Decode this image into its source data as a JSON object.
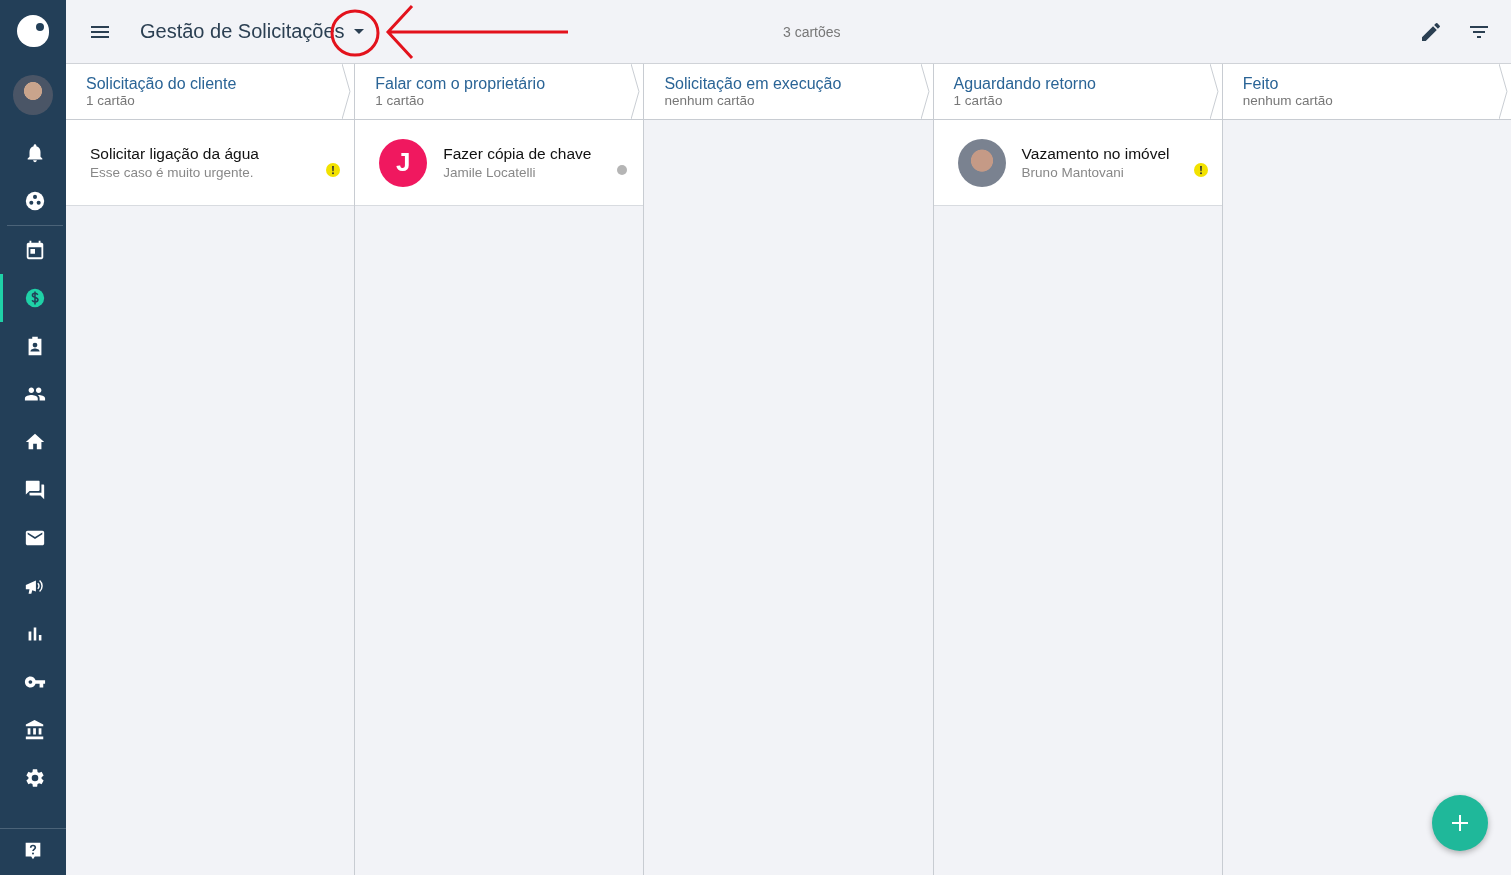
{
  "sidebar": {
    "items": [
      {
        "selected": false
      },
      {
        "selected": false
      },
      {
        "selected": false
      },
      {
        "selected": true
      },
      {
        "selected": false
      },
      {
        "selected": false
      },
      {
        "selected": false
      },
      {
        "selected": false
      },
      {
        "selected": false
      },
      {
        "selected": false
      },
      {
        "selected": false
      },
      {
        "selected": false
      },
      {
        "selected": false
      },
      {
        "selected": false
      }
    ]
  },
  "header": {
    "title": "Gestão de Solicitações",
    "card_count": "3 cartões"
  },
  "columns": [
    {
      "title": "Solicitação do cliente",
      "count": "1 cartão",
      "cards": [
        {
          "kind": "plain",
          "title": "Solicitar ligação da água",
          "subtitle": "Esse caso é muito urgente.",
          "urgent": true
        }
      ]
    },
    {
      "title": "Falar com o proprietário",
      "count": "1 cartão",
      "cards": [
        {
          "kind": "initial",
          "initial": "J",
          "color": "#f0185f",
          "title": "Fazer cópia de chave",
          "subtitle": "Jamile Locatelli",
          "urgent": false
        }
      ]
    },
    {
      "title": "Solicitação em execução",
      "count": "nenhum cartão"
    },
    {
      "title": "Aguardando retorno",
      "count": "1 cartão",
      "cards": [
        {
          "kind": "photo",
          "title": "Vazamento no imóvel",
          "subtitle": "Bruno Mantovani",
          "urgent": true
        }
      ]
    },
    {
      "title": "Feito",
      "count": "nenhum cartão"
    }
  ]
}
